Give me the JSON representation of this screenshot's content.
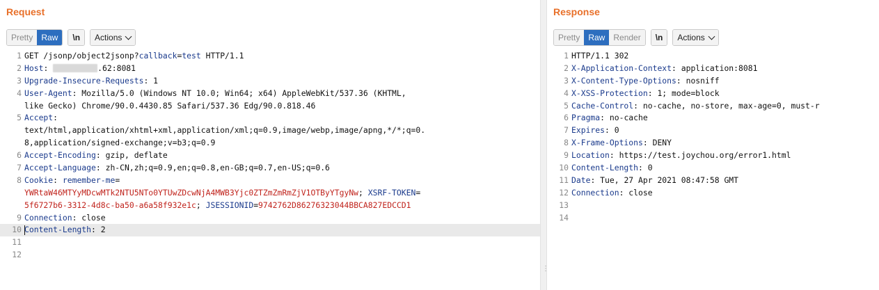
{
  "request": {
    "title": "Request",
    "toolbar": {
      "pretty": "Pretty",
      "raw": "Raw",
      "newline": "\\n",
      "actions": "Actions"
    },
    "lines": [
      {
        "n": "1",
        "parts": [
          {
            "t": "GET /jsonp/object2jsonp?"
          },
          {
            "t": "callback",
            "c": "k"
          },
          {
            "t": "="
          },
          {
            "t": "test",
            "c": "k"
          },
          {
            "t": " HTTP/1.1"
          }
        ]
      },
      {
        "n": "2",
        "parts": [
          {
            "t": "Host",
            "c": "k"
          },
          {
            "t": ": "
          },
          {
            "t": "redacted",
            "c": "redact"
          },
          {
            "t": ".62:8081"
          }
        ]
      },
      {
        "n": "3",
        "parts": [
          {
            "t": "Upgrade-Insecure-Requests",
            "c": "k"
          },
          {
            "t": ": 1"
          }
        ]
      },
      {
        "n": "4",
        "parts": [
          {
            "t": "User-Agent",
            "c": "k"
          },
          {
            "t": ": Mozilla/5.0 (Windows NT 10.0; Win64; x64) AppleWebKit/537.36 (KHTML,"
          }
        ]
      },
      {
        "n": "",
        "parts": [
          {
            "t": "like Gecko) Chrome/90.0.4430.85 Safari/537.36 Edg/90.0.818.46"
          }
        ]
      },
      {
        "n": "5",
        "parts": [
          {
            "t": "Accept",
            "c": "k"
          },
          {
            "t": ":"
          }
        ]
      },
      {
        "n": "",
        "parts": [
          {
            "t": "text/html,application/xhtml+xml,application/xml;q=0.9,image/webp,image/apng,*/*;q=0."
          }
        ]
      },
      {
        "n": "",
        "parts": [
          {
            "t": "8,application/signed-exchange;v=b3;q=0.9"
          }
        ]
      },
      {
        "n": "6",
        "parts": [
          {
            "t": "Accept-Encoding",
            "c": "k"
          },
          {
            "t": ": gzip, deflate"
          }
        ]
      },
      {
        "n": "7",
        "parts": [
          {
            "t": "Accept-Language",
            "c": "k"
          },
          {
            "t": ": zh-CN,zh;q=0.9,en;q=0.8,en-GB;q=0.7,en-US;q=0.6"
          }
        ]
      },
      {
        "n": "8",
        "parts": [
          {
            "t": "Cookie",
            "c": "k"
          },
          {
            "t": ": "
          },
          {
            "t": "remember-me",
            "c": "k"
          },
          {
            "t": "="
          }
        ]
      },
      {
        "n": "",
        "parts": [
          {
            "t": "YWRtaW46MTYyMDcwMTk2NTU5NTo0YTUwZDcwNjA4MWB3Yjc0ZTZmZmRmZjV1OTByYTgyNw",
            "c": "r"
          },
          {
            "t": "; "
          },
          {
            "t": "XSRF-TOKEN",
            "c": "k"
          },
          {
            "t": "="
          }
        ]
      },
      {
        "n": "",
        "parts": [
          {
            "t": "5f6727b6-3312-4d8c-ba50-a6a58f932e1c",
            "c": "r"
          },
          {
            "t": "; "
          },
          {
            "t": "JSESSIONID",
            "c": "k"
          },
          {
            "t": "="
          },
          {
            "t": "9742762D86276323044BBCA827EDCCD1",
            "c": "r"
          }
        ]
      },
      {
        "n": "9",
        "parts": [
          {
            "t": "Connection",
            "c": "k"
          },
          {
            "t": ": close"
          }
        ]
      },
      {
        "n": "10",
        "hl": true,
        "caret": true,
        "parts": [
          {
            "t": "Content-Length",
            "c": "k"
          },
          {
            "t": ": 2"
          }
        ]
      },
      {
        "n": "11",
        "parts": []
      },
      {
        "n": "12",
        "parts": []
      }
    ]
  },
  "response": {
    "title": "Response",
    "toolbar": {
      "pretty": "Pretty",
      "raw": "Raw",
      "render": "Render",
      "newline": "\\n",
      "actions": "Actions"
    },
    "lines": [
      {
        "n": "1",
        "parts": [
          {
            "t": "HTTP/1.1 302"
          }
        ]
      },
      {
        "n": "2",
        "parts": [
          {
            "t": "X-Application-Context",
            "c": "k"
          },
          {
            "t": ": application:8081"
          }
        ]
      },
      {
        "n": "3",
        "parts": [
          {
            "t": "X-Content-Type-Options",
            "c": "k"
          },
          {
            "t": ": nosniff"
          }
        ]
      },
      {
        "n": "4",
        "parts": [
          {
            "t": "X-XSS-Protection",
            "c": "k"
          },
          {
            "t": ": 1; mode=block"
          }
        ]
      },
      {
        "n": "5",
        "parts": [
          {
            "t": "Cache-Control",
            "c": "k"
          },
          {
            "t": ": no-cache, no-store, max-age=0, must-r"
          }
        ]
      },
      {
        "n": "6",
        "parts": [
          {
            "t": "Pragma",
            "c": "k"
          },
          {
            "t": ": no-cache"
          }
        ]
      },
      {
        "n": "7",
        "parts": [
          {
            "t": "Expires",
            "c": "k"
          },
          {
            "t": ": 0"
          }
        ]
      },
      {
        "n": "8",
        "parts": [
          {
            "t": "X-Frame-Options",
            "c": "k"
          },
          {
            "t": ": DENY"
          }
        ]
      },
      {
        "n": "9",
        "parts": [
          {
            "t": "Location",
            "c": "k"
          },
          {
            "t": ": https://test.joychou.org/error1.html"
          }
        ]
      },
      {
        "n": "10",
        "parts": [
          {
            "t": "Content-Length",
            "c": "k"
          },
          {
            "t": ": 0"
          }
        ]
      },
      {
        "n": "11",
        "parts": [
          {
            "t": "Date",
            "c": "k"
          },
          {
            "t": ": Tue, 27 Apr 2021 08:47:58 GMT"
          }
        ]
      },
      {
        "n": "12",
        "parts": [
          {
            "t": "Connection",
            "c": "k"
          },
          {
            "t": ": close"
          }
        ]
      },
      {
        "n": "13",
        "parts": []
      },
      {
        "n": "14",
        "parts": []
      }
    ]
  },
  "splitter": {
    "grip": "⋮"
  },
  "colors": {
    "title": "#e8702a",
    "active_tab": "#2d6ebf",
    "key": "#1a3a8c",
    "value_red": "#c0231c"
  }
}
